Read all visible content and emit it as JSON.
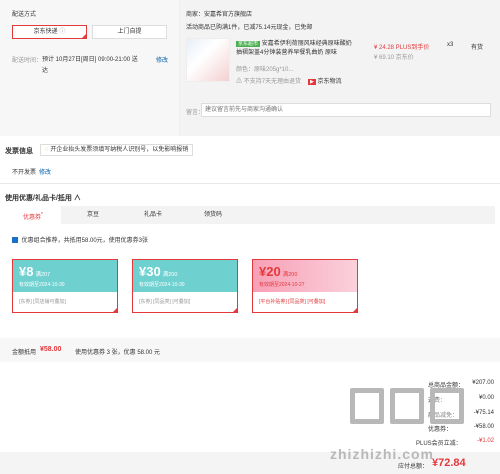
{
  "delivery": {
    "title": "配送方式",
    "options": [
      "京东快递",
      "上门自提"
    ],
    "time_label": "配送时间：",
    "time_value": "预计 10月27日[周日] 09:00-21:00 送达",
    "edit": "修改"
  },
  "store": {
    "merchant": "商家：安嘉希官方旗舰店",
    "promo": "活动商品已购满1件，已减75.14元现金，已免邮",
    "product_tag": "京东超市",
    "product_name": "安嘉希伊利荷丽风味经典原味酸奶抽褶架盖4分钟装营养早餐乳曲奶 原味",
    "spec": "颜色：原味205g*10...",
    "price": "¥ 24.28 PLUS到手价",
    "orig_price": "¥ 69.10 京东价",
    "qty": "x3",
    "stock": "有货",
    "service1": "不支持7天无理由退货",
    "service2": "京东物流",
    "memo_label": "留言：",
    "memo_placeholder": "建议留言前先与商家沟通确认"
  },
  "invoice": {
    "title": "发票信息",
    "hint": "开企业抬头发票须填写纳税人识别号，以免影响报销",
    "value": "不开发票",
    "edit": "修改"
  },
  "coupons": {
    "section_title": "使用优惠/礼品卡/抵用 ∧",
    "tabs": [
      "优惠券",
      "京豆",
      "礼品卡",
      "领货码"
    ],
    "tab_badge": "*",
    "auto_text": "优惠组合推荐，共抵用58.00元，使用优惠券3张",
    "items": [
      {
        "amount": "¥8",
        "cond": "满207",
        "date": "有效期至2024-10-30",
        "tags": "[东券]  [同店铺可叠加]",
        "color": "#6fd0d0"
      },
      {
        "amount": "¥30",
        "cond": "满200",
        "date": "有效期至2024-10-30",
        "tags": "[东券]  [同品类]  [可叠加]",
        "color": "#6fd0d0"
      },
      {
        "amount": "¥20",
        "cond": "满200",
        "date": "有效期至2024-10-27",
        "tags": "[平台补贴券]  [同品类]  [可叠加]",
        "color": "#f7a0b6"
      }
    ],
    "summary_label": "金额抵用",
    "summary_amount": "¥58.00",
    "summary_detail": "使用优惠券 3 张，优惠 58.00 元"
  },
  "totals": {
    "rows": [
      {
        "k": "总商品金额：",
        "v": "¥207.00"
      },
      {
        "k": "运费：",
        "v": "¥0.00"
      },
      {
        "k": "商品减免：",
        "v": "-¥75.14"
      },
      {
        "k": "优惠券：",
        "v": "-¥58.00"
      },
      {
        "k": "PLUS会员立减：",
        "v": "-¥1.02"
      }
    ],
    "pay_label": "应付总额：",
    "pay_amount": "¥72.84"
  },
  "watermark": "zhizhizhi.com"
}
